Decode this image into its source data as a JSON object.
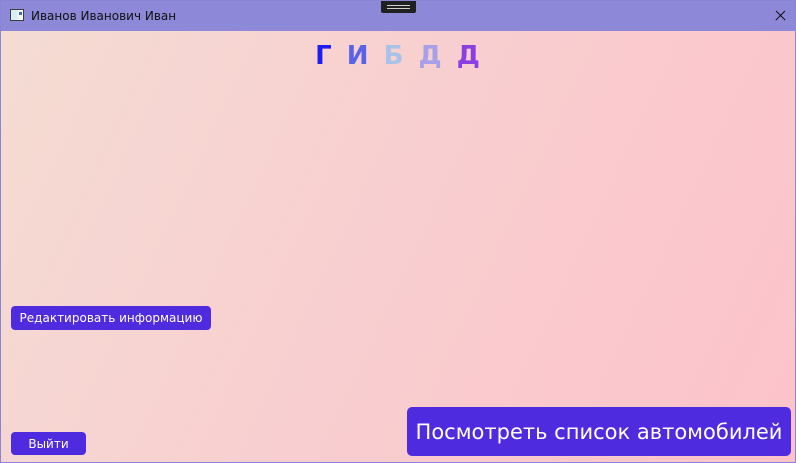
{
  "window": {
    "title": "Иванов Иванович Иван"
  },
  "logo": {
    "letters": [
      {
        "char": "Г",
        "color": "#1f1ef0"
      },
      {
        "char": "И",
        "color": "#5a63e8"
      },
      {
        "char": "Б",
        "color": "#a9c3e8"
      },
      {
        "char": "Д",
        "color": "#a7a0e6"
      },
      {
        "char": "Д",
        "color": "#8b3fe0"
      }
    ]
  },
  "buttons": {
    "edit_label": "Редактировать информацию",
    "exit_label": "Выйти",
    "cars_label": "Посмотреть список автомобилей"
  },
  "colors": {
    "titlebar": "#8d89d8",
    "button": "#4f2be0"
  }
}
